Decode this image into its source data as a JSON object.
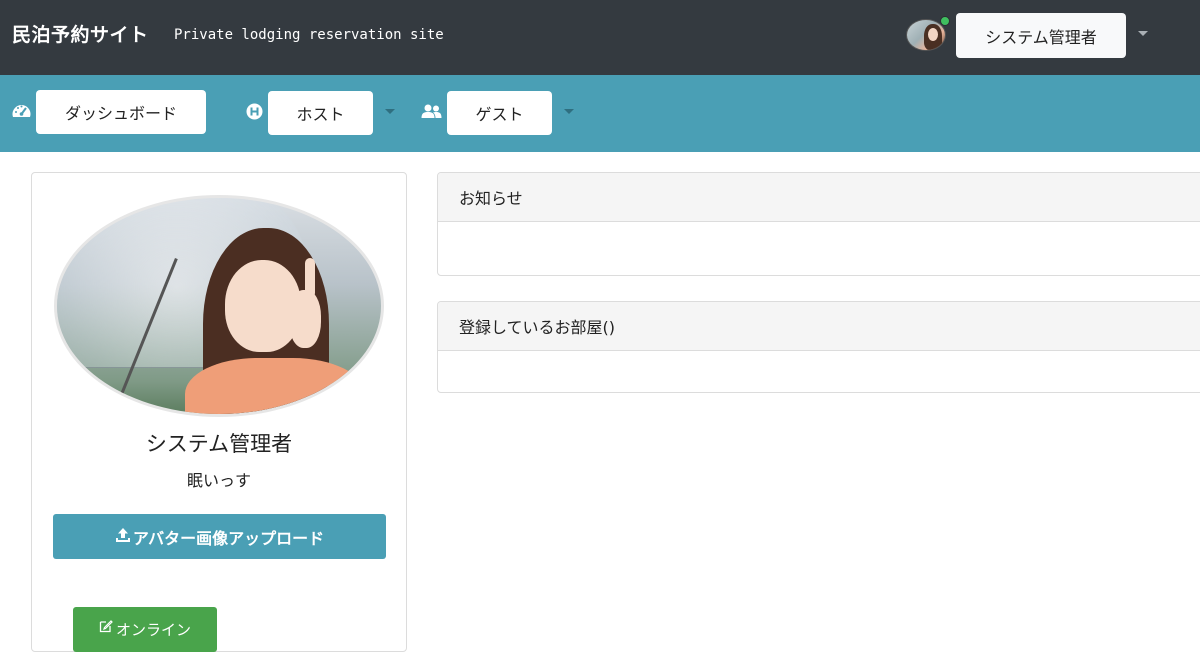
{
  "header": {
    "site_title": "民泊予約サイト",
    "site_subtitle": "Private lodging reservation site",
    "user_menu_label": "システム管理者",
    "user_online": true
  },
  "nav": {
    "items": [
      {
        "label": "ダッシュボード",
        "icon": "dashboard-icon"
      },
      {
        "label": "ホスト",
        "icon": "host-h-icon",
        "has_dropdown": true
      },
      {
        "label": "ゲスト",
        "icon": "users-icon",
        "has_dropdown": true
      }
    ]
  },
  "profile": {
    "name": "システム管理者",
    "status_message": "眠いっす",
    "upload_button_label": "アバター画像アップロード",
    "upload_icon": "upload-icon",
    "online_button_label": "オンライン",
    "online_icon": "edit-icon"
  },
  "panels": [
    {
      "title": "お知らせ"
    },
    {
      "title": "登録しているお部屋()"
    }
  ],
  "colors": {
    "topbar": "#343a40",
    "navbar": "#4a9fb5",
    "upload_button": "#4a9fb5",
    "online_button": "#49a44b",
    "online_dot": "#3fbf5f"
  }
}
